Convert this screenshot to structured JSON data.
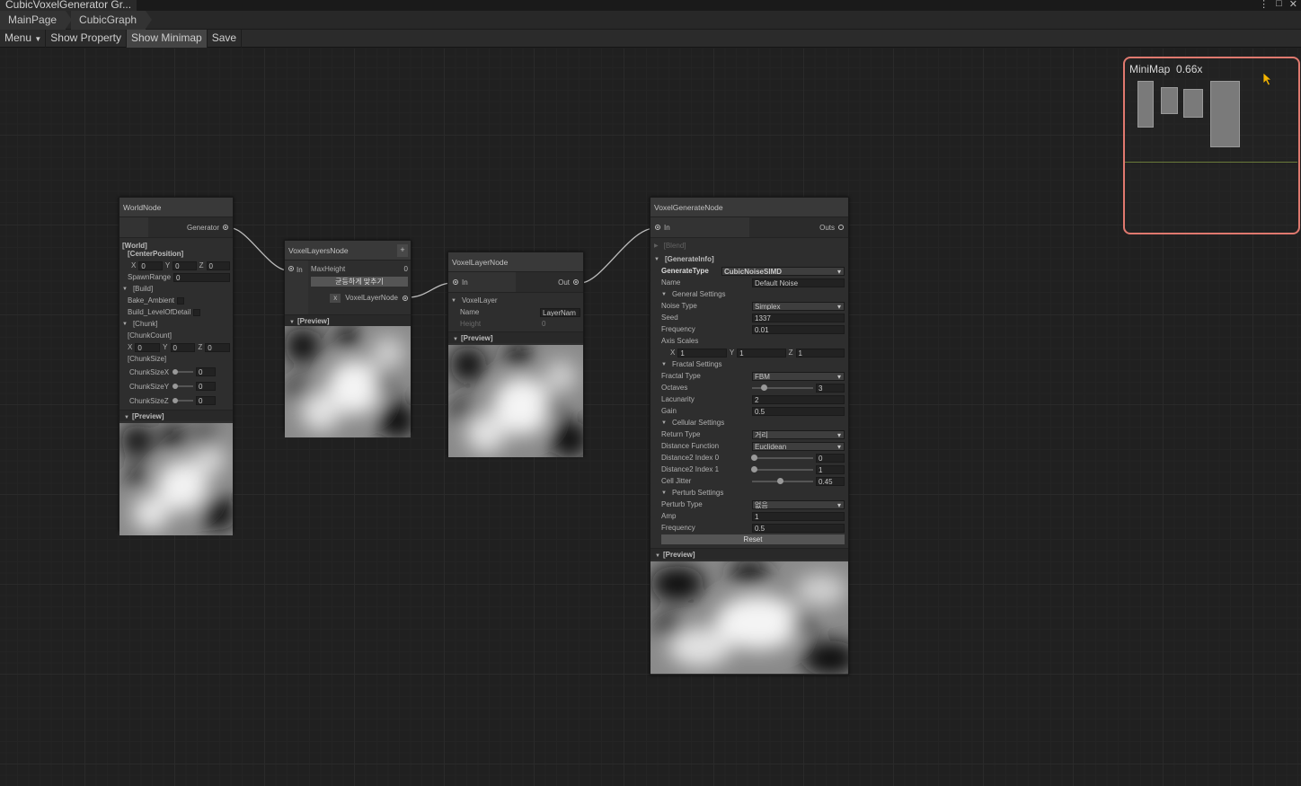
{
  "window": {
    "title": "CubicVoxelGenerator Gr...",
    "controls": [
      "⋮",
      "□",
      "✕"
    ]
  },
  "breadcrumb": [
    "MainPage",
    "CubicGraph"
  ],
  "toolbar": {
    "menu": "Menu",
    "show_property": "Show Property",
    "show_minimap": "Show Minimap",
    "save": "Save"
  },
  "world_node": {
    "title": "WorldNode",
    "out_port": "Generator",
    "world": "[World]",
    "center_position": "[CenterPosition]",
    "cx": "0",
    "cy": "0",
    "cz": "0",
    "spawn_range_label": "SpawnRange",
    "spawn_range": "0",
    "build": "[Build]",
    "bake_ambient": "Bake_Ambient",
    "build_lod": "Build_LevelOfDetail",
    "chunk": "[Chunk]",
    "chunk_count": "[ChunkCount]",
    "ccx": "0",
    "ccy": "0",
    "ccz": "0",
    "chunk_size": "[ChunkSize]",
    "size_x_label": "ChunkSizeX",
    "size_y_label": "ChunkSizeY",
    "size_z_label": "ChunkSizeZ",
    "size_x": "0",
    "size_y": "0",
    "size_z": "0",
    "preview": "[Preview]"
  },
  "layers_node": {
    "title": "VoxelLayersNode",
    "add": "+",
    "in_port": "In",
    "max_height_label": "MaxHeight",
    "max_height": "0",
    "even_button": "균등하게 맞추기",
    "remove": "x",
    "out_port": "VoxelLayerNode",
    "preview": "[Preview]"
  },
  "layer_node": {
    "title": "VoxelLayerNode",
    "in_port": "In",
    "out_port": "Out",
    "voxel_layer": "VoxelLayer",
    "name_label": "Name",
    "name": "LayerNam",
    "height_label": "Height",
    "height": "0",
    "preview": "[Preview]"
  },
  "generate_node": {
    "title": "VoxelGenerateNode",
    "in_port": "In",
    "out_port": "Outs",
    "blend": "[Blend]",
    "generate_info": "[GenerateInfo]",
    "generate_type_label": "GenerateType",
    "generate_type": "CubicNoiseSIMD",
    "name_label": "Name",
    "name": "Default Noise",
    "general_settings": "General Settings",
    "noise_type_label": "Noise Type",
    "noise_type": "Simplex",
    "seed_label": "Seed",
    "seed": "1337",
    "frequency_label": "Frequency",
    "frequency": "0.01",
    "axis_scales_label": "Axis Scales",
    "ax": "1",
    "ay": "1",
    "az": "1",
    "fractal_settings": "Fractal Settings",
    "fractal_type_label": "Fractal Type",
    "fractal_type": "FBM",
    "octaves_label": "Octaves",
    "octaves": "3",
    "lacunarity_label": "Lacunarity",
    "lacunarity": "2",
    "gain_label": "Gain",
    "gain": "0.5",
    "cellular_settings": "Cellular Settings",
    "return_type_label": "Return Type",
    "return_type": "거리",
    "distance_function_label": "Distance Function",
    "distance_function": "Euclidean",
    "d2i0_label": "Distance2 Index 0",
    "d2i0": "0",
    "d2i1_label": "Distance2 Index 1",
    "d2i1": "1",
    "cell_jitter_label": "Cell Jitter",
    "cell_jitter": "0.45",
    "perturb_settings": "Perturb Settings",
    "perturb_type_label": "Perturb Type",
    "perturb_type": "없음",
    "amp_label": "Amp",
    "amp": "1",
    "p_frequency_label": "Frequency",
    "p_frequency": "0.5",
    "reset": "Reset",
    "preview": "[Preview]"
  },
  "minimap": {
    "title": "MiniMap",
    "zoom": "0.66x"
  },
  "axis_labels": {
    "x": "X",
    "y": "Y",
    "z": "Z"
  }
}
